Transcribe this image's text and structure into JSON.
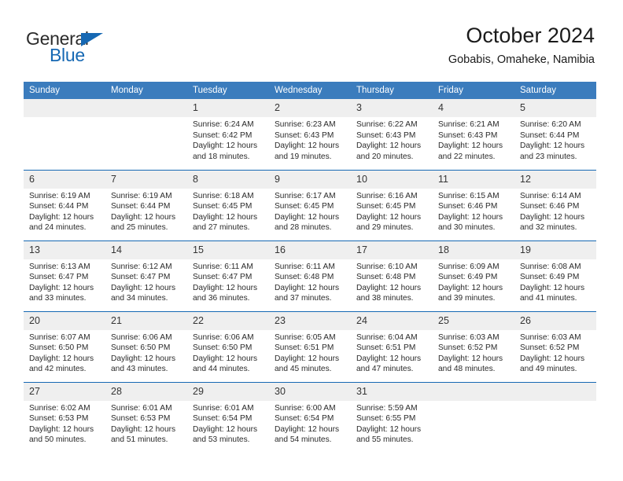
{
  "brand": {
    "name_part1": "General",
    "name_part2": "Blue",
    "triangle_color": "#1668b3"
  },
  "header": {
    "title": "October 2024",
    "subtitle": "Gobabis, Omaheke, Namibia"
  },
  "theme": {
    "header_bg": "#3b7cbd",
    "rule_color": "#1668b3",
    "daynum_bg": "#efefef"
  },
  "weekday_headers": [
    "Sunday",
    "Monday",
    "Tuesday",
    "Wednesday",
    "Thursday",
    "Friday",
    "Saturday"
  ],
  "labels": {
    "sunrise_prefix": "Sunrise:",
    "sunset_prefix": "Sunset:",
    "daylight_prefix": "Daylight:"
  },
  "weeks": [
    [
      {
        "day": "",
        "empty": true
      },
      {
        "day": "",
        "empty": true
      },
      {
        "day": "1",
        "sunrise": "Sunrise: 6:24 AM",
        "sunset": "Sunset: 6:42 PM",
        "daylight_line1": "Daylight: 12 hours",
        "daylight_line2": "and 18 minutes."
      },
      {
        "day": "2",
        "sunrise": "Sunrise: 6:23 AM",
        "sunset": "Sunset: 6:43 PM",
        "daylight_line1": "Daylight: 12 hours",
        "daylight_line2": "and 19 minutes."
      },
      {
        "day": "3",
        "sunrise": "Sunrise: 6:22 AM",
        "sunset": "Sunset: 6:43 PM",
        "daylight_line1": "Daylight: 12 hours",
        "daylight_line2": "and 20 minutes."
      },
      {
        "day": "4",
        "sunrise": "Sunrise: 6:21 AM",
        "sunset": "Sunset: 6:43 PM",
        "daylight_line1": "Daylight: 12 hours",
        "daylight_line2": "and 22 minutes."
      },
      {
        "day": "5",
        "sunrise": "Sunrise: 6:20 AM",
        "sunset": "Sunset: 6:44 PM",
        "daylight_line1": "Daylight: 12 hours",
        "daylight_line2": "and 23 minutes."
      }
    ],
    [
      {
        "day": "6",
        "sunrise": "Sunrise: 6:19 AM",
        "sunset": "Sunset: 6:44 PM",
        "daylight_line1": "Daylight: 12 hours",
        "daylight_line2": "and 24 minutes."
      },
      {
        "day": "7",
        "sunrise": "Sunrise: 6:19 AM",
        "sunset": "Sunset: 6:44 PM",
        "daylight_line1": "Daylight: 12 hours",
        "daylight_line2": "and 25 minutes."
      },
      {
        "day": "8",
        "sunrise": "Sunrise: 6:18 AM",
        "sunset": "Sunset: 6:45 PM",
        "daylight_line1": "Daylight: 12 hours",
        "daylight_line2": "and 27 minutes."
      },
      {
        "day": "9",
        "sunrise": "Sunrise: 6:17 AM",
        "sunset": "Sunset: 6:45 PM",
        "daylight_line1": "Daylight: 12 hours",
        "daylight_line2": "and 28 minutes."
      },
      {
        "day": "10",
        "sunrise": "Sunrise: 6:16 AM",
        "sunset": "Sunset: 6:45 PM",
        "daylight_line1": "Daylight: 12 hours",
        "daylight_line2": "and 29 minutes."
      },
      {
        "day": "11",
        "sunrise": "Sunrise: 6:15 AM",
        "sunset": "Sunset: 6:46 PM",
        "daylight_line1": "Daylight: 12 hours",
        "daylight_line2": "and 30 minutes."
      },
      {
        "day": "12",
        "sunrise": "Sunrise: 6:14 AM",
        "sunset": "Sunset: 6:46 PM",
        "daylight_line1": "Daylight: 12 hours",
        "daylight_line2": "and 32 minutes."
      }
    ],
    [
      {
        "day": "13",
        "sunrise": "Sunrise: 6:13 AM",
        "sunset": "Sunset: 6:47 PM",
        "daylight_line1": "Daylight: 12 hours",
        "daylight_line2": "and 33 minutes."
      },
      {
        "day": "14",
        "sunrise": "Sunrise: 6:12 AM",
        "sunset": "Sunset: 6:47 PM",
        "daylight_line1": "Daylight: 12 hours",
        "daylight_line2": "and 34 minutes."
      },
      {
        "day": "15",
        "sunrise": "Sunrise: 6:11 AM",
        "sunset": "Sunset: 6:47 PM",
        "daylight_line1": "Daylight: 12 hours",
        "daylight_line2": "and 36 minutes."
      },
      {
        "day": "16",
        "sunrise": "Sunrise: 6:11 AM",
        "sunset": "Sunset: 6:48 PM",
        "daylight_line1": "Daylight: 12 hours",
        "daylight_line2": "and 37 minutes."
      },
      {
        "day": "17",
        "sunrise": "Sunrise: 6:10 AM",
        "sunset": "Sunset: 6:48 PM",
        "daylight_line1": "Daylight: 12 hours",
        "daylight_line2": "and 38 minutes."
      },
      {
        "day": "18",
        "sunrise": "Sunrise: 6:09 AM",
        "sunset": "Sunset: 6:49 PM",
        "daylight_line1": "Daylight: 12 hours",
        "daylight_line2": "and 39 minutes."
      },
      {
        "day": "19",
        "sunrise": "Sunrise: 6:08 AM",
        "sunset": "Sunset: 6:49 PM",
        "daylight_line1": "Daylight: 12 hours",
        "daylight_line2": "and 41 minutes."
      }
    ],
    [
      {
        "day": "20",
        "sunrise": "Sunrise: 6:07 AM",
        "sunset": "Sunset: 6:50 PM",
        "daylight_line1": "Daylight: 12 hours",
        "daylight_line2": "and 42 minutes."
      },
      {
        "day": "21",
        "sunrise": "Sunrise: 6:06 AM",
        "sunset": "Sunset: 6:50 PM",
        "daylight_line1": "Daylight: 12 hours",
        "daylight_line2": "and 43 minutes."
      },
      {
        "day": "22",
        "sunrise": "Sunrise: 6:06 AM",
        "sunset": "Sunset: 6:50 PM",
        "daylight_line1": "Daylight: 12 hours",
        "daylight_line2": "and 44 minutes."
      },
      {
        "day": "23",
        "sunrise": "Sunrise: 6:05 AM",
        "sunset": "Sunset: 6:51 PM",
        "daylight_line1": "Daylight: 12 hours",
        "daylight_line2": "and 45 minutes."
      },
      {
        "day": "24",
        "sunrise": "Sunrise: 6:04 AM",
        "sunset": "Sunset: 6:51 PM",
        "daylight_line1": "Daylight: 12 hours",
        "daylight_line2": "and 47 minutes."
      },
      {
        "day": "25",
        "sunrise": "Sunrise: 6:03 AM",
        "sunset": "Sunset: 6:52 PM",
        "daylight_line1": "Daylight: 12 hours",
        "daylight_line2": "and 48 minutes."
      },
      {
        "day": "26",
        "sunrise": "Sunrise: 6:03 AM",
        "sunset": "Sunset: 6:52 PM",
        "daylight_line1": "Daylight: 12 hours",
        "daylight_line2": "and 49 minutes."
      }
    ],
    [
      {
        "day": "27",
        "sunrise": "Sunrise: 6:02 AM",
        "sunset": "Sunset: 6:53 PM",
        "daylight_line1": "Daylight: 12 hours",
        "daylight_line2": "and 50 minutes."
      },
      {
        "day": "28",
        "sunrise": "Sunrise: 6:01 AM",
        "sunset": "Sunset: 6:53 PM",
        "daylight_line1": "Daylight: 12 hours",
        "daylight_line2": "and 51 minutes."
      },
      {
        "day": "29",
        "sunrise": "Sunrise: 6:01 AM",
        "sunset": "Sunset: 6:54 PM",
        "daylight_line1": "Daylight: 12 hours",
        "daylight_line2": "and 53 minutes."
      },
      {
        "day": "30",
        "sunrise": "Sunrise: 6:00 AM",
        "sunset": "Sunset: 6:54 PM",
        "daylight_line1": "Daylight: 12 hours",
        "daylight_line2": "and 54 minutes."
      },
      {
        "day": "31",
        "sunrise": "Sunrise: 5:59 AM",
        "sunset": "Sunset: 6:55 PM",
        "daylight_line1": "Daylight: 12 hours",
        "daylight_line2": "and 55 minutes."
      },
      {
        "day": "",
        "empty": true
      },
      {
        "day": "",
        "empty": true
      }
    ]
  ]
}
